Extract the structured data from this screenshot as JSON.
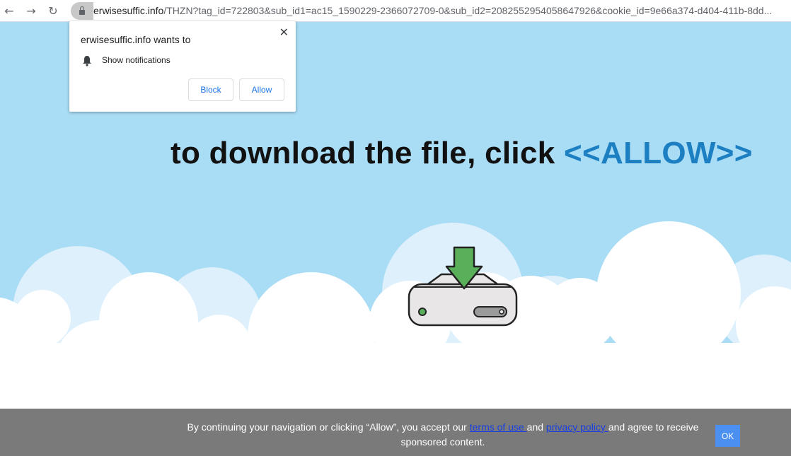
{
  "browser": {
    "url_host": "erwisesuffic.info",
    "url_path": "/THZN?tag_id=722803&sub_id1=ac15_1590229-2366072709-0&sub_id2=2082552954058647926&cookie_id=9e66a374-d404-411b-8dd..."
  },
  "popup": {
    "title": "erwisesuffic.info wants to",
    "permission": "Show notifications",
    "block_label": "Block",
    "allow_label": "Allow",
    "close_symbol": "✕"
  },
  "headline": {
    "text": "to download the file, click ",
    "highlight": "<<ALLOW>>"
  },
  "banner": {
    "text_before": "By continuing your navigation or clicking “Allow”, you accept our ",
    "terms_link": "terms of use ",
    "text_middle": "and ",
    "privacy_link": "privacy policy ",
    "text_after": "and agree to receive sponsored content.",
    "ok_label": "OK"
  },
  "colors": {
    "sky": "#a9dcf5",
    "highlight": "#1b7fc2",
    "banner_bg": "#7a7a7a",
    "ok_button": "#4b8ff0",
    "arrow_green": "#5ab05a"
  },
  "icons": {
    "back": "back-arrow-icon",
    "forward": "forward-arrow-icon",
    "reload": "reload-icon",
    "lock": "lock-icon",
    "bell": "bell-icon",
    "close": "close-icon",
    "drive": "hard-drive-download-icon"
  }
}
